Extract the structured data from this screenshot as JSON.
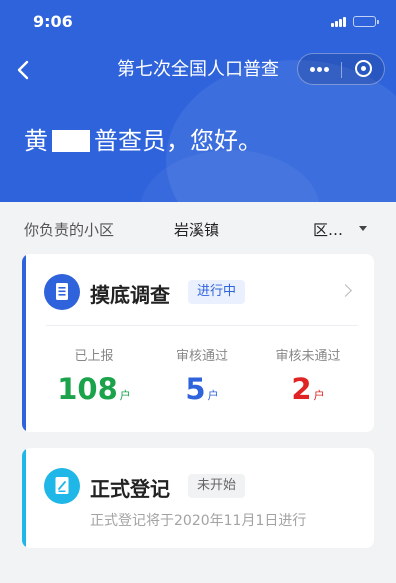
{
  "status_bar": {
    "time": "9:06"
  },
  "nav": {
    "title": "第七次全国人口普查"
  },
  "greeting": {
    "prefix": "黄",
    "suffix": "普查员，您好。"
  },
  "area": {
    "label": "你负责的小区",
    "value_prefix": "岩溪镇",
    "value_suffix": "区…"
  },
  "cards": {
    "baseline": {
      "title": "摸底调查",
      "status": "进行中",
      "accent_color": "#2f63dc",
      "stats": [
        {
          "label": "已上报",
          "value": "108",
          "unit": "户",
          "color": "#1aa34a"
        },
        {
          "label": "审核通过",
          "value": "5",
          "unit": "户",
          "color": "#2f63dc"
        },
        {
          "label": "审核未通过",
          "value": "2",
          "unit": "户",
          "color": "#e02424"
        }
      ]
    },
    "registration": {
      "title": "正式登记",
      "status": "未开始",
      "note": "正式登记将于2020年11月1日进行",
      "accent_color": "#1fb6e8"
    }
  }
}
